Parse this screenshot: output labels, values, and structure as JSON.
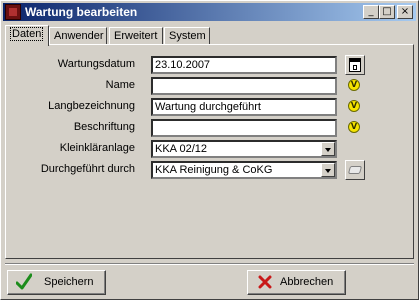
{
  "window": {
    "title": "Wartung bearbeiten",
    "minimize_glyph": "_",
    "maximize_glyph": "□",
    "close_glyph": "×"
  },
  "tabs": [
    {
      "label": "Daten",
      "active": true
    },
    {
      "label": "Anwender",
      "active": false
    },
    {
      "label": "Erweitert",
      "active": false
    },
    {
      "label": "System",
      "active": false
    }
  ],
  "form": {
    "wartungsdatum": {
      "label": "Wartungsdatum",
      "value": "23.10.2007"
    },
    "name": {
      "label": "Name",
      "value": ""
    },
    "langbezeichnung": {
      "label": "Langbezeichnung",
      "value": "Wartung durchgeführt"
    },
    "beschriftung": {
      "label": "Beschriftung",
      "value": ""
    },
    "kleinklaeranlage": {
      "label": "Kleinkläranlage",
      "value": "KKA 02/12"
    },
    "durchgefuehrt_durch": {
      "label": "Durchgeführt durch",
      "value": "KKA Reinigung & CoKG"
    }
  },
  "icons": {
    "v_glyph": "V"
  },
  "buttons": {
    "save": "Speichern",
    "cancel": "Abbrechen"
  },
  "colors": {
    "titlebar_start": "#0a246a",
    "titlebar_end": "#a6caf0",
    "face": "#d4d0c8",
    "save_check": "#1c8c1c",
    "cancel_x": "#c81818",
    "v_icon": "#f5e400"
  }
}
